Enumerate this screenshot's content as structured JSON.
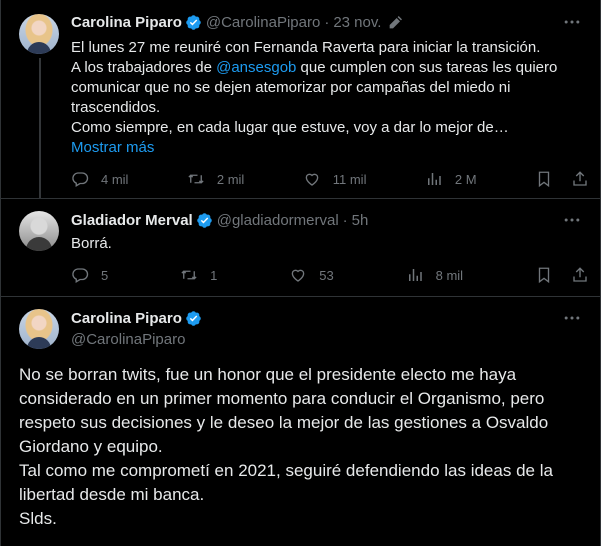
{
  "tweet1": {
    "name": "Carolina Piparo",
    "handle": "@CarolinaPiparo",
    "time": "23 nov.",
    "text_line1": "El lunes 27 me reuniré con Fernanda Raverta para iniciar la transición.",
    "text_line2_pre": "A los trabajadores de ",
    "text_mention": "@ansesgob",
    "text_line2_post": " que cumplen con sus tareas les quiero",
    "text_line3": "comunicar que no se dejen atemorizar por campañas del miedo ni",
    "text_line4": "trascendidos.",
    "text_line5": "Como siempre, en cada lugar que estuve, voy a dar lo mejor de…",
    "show_more": "Mostrar más",
    "replies": "4 mil",
    "retweets": "2 mil",
    "likes": "11 mil",
    "views": "2 M"
  },
  "tweet2": {
    "name": "Gladiador Merval",
    "handle": "@gladiadormerval",
    "time": "5h",
    "text": "Borrá.",
    "replies": "5",
    "retweets": "1",
    "likes": "53",
    "views": "8 mil"
  },
  "tweet3": {
    "name": "Carolina Piparo",
    "handle": "@CarolinaPiparo",
    "line1": "No se borran twits, fue un honor que el presidente electo me haya",
    "line2": "considerado en un primer momento para conducir el Organismo, pero",
    "line3": "respeto sus decisiones y le deseo la mejor de las gestiones a Osvaldo",
    "line4": "Giordano y equipo.",
    "line5": "Tal como me comprometí en 2021, seguiré defendiendo las ideas de la",
    "line6": "libertad desde mi banca.",
    "line7": "Slds."
  },
  "colors": {
    "background": "#000000",
    "text": "#e7e9ea",
    "muted": "#71767b",
    "accent": "#1d9bf0",
    "divider": "#2f3336"
  },
  "icons": [
    "verified-badge-icon",
    "edit-icon",
    "more-icon",
    "reply-icon",
    "retweet-icon",
    "like-icon",
    "views-icon",
    "bookmark-icon",
    "share-icon"
  ]
}
